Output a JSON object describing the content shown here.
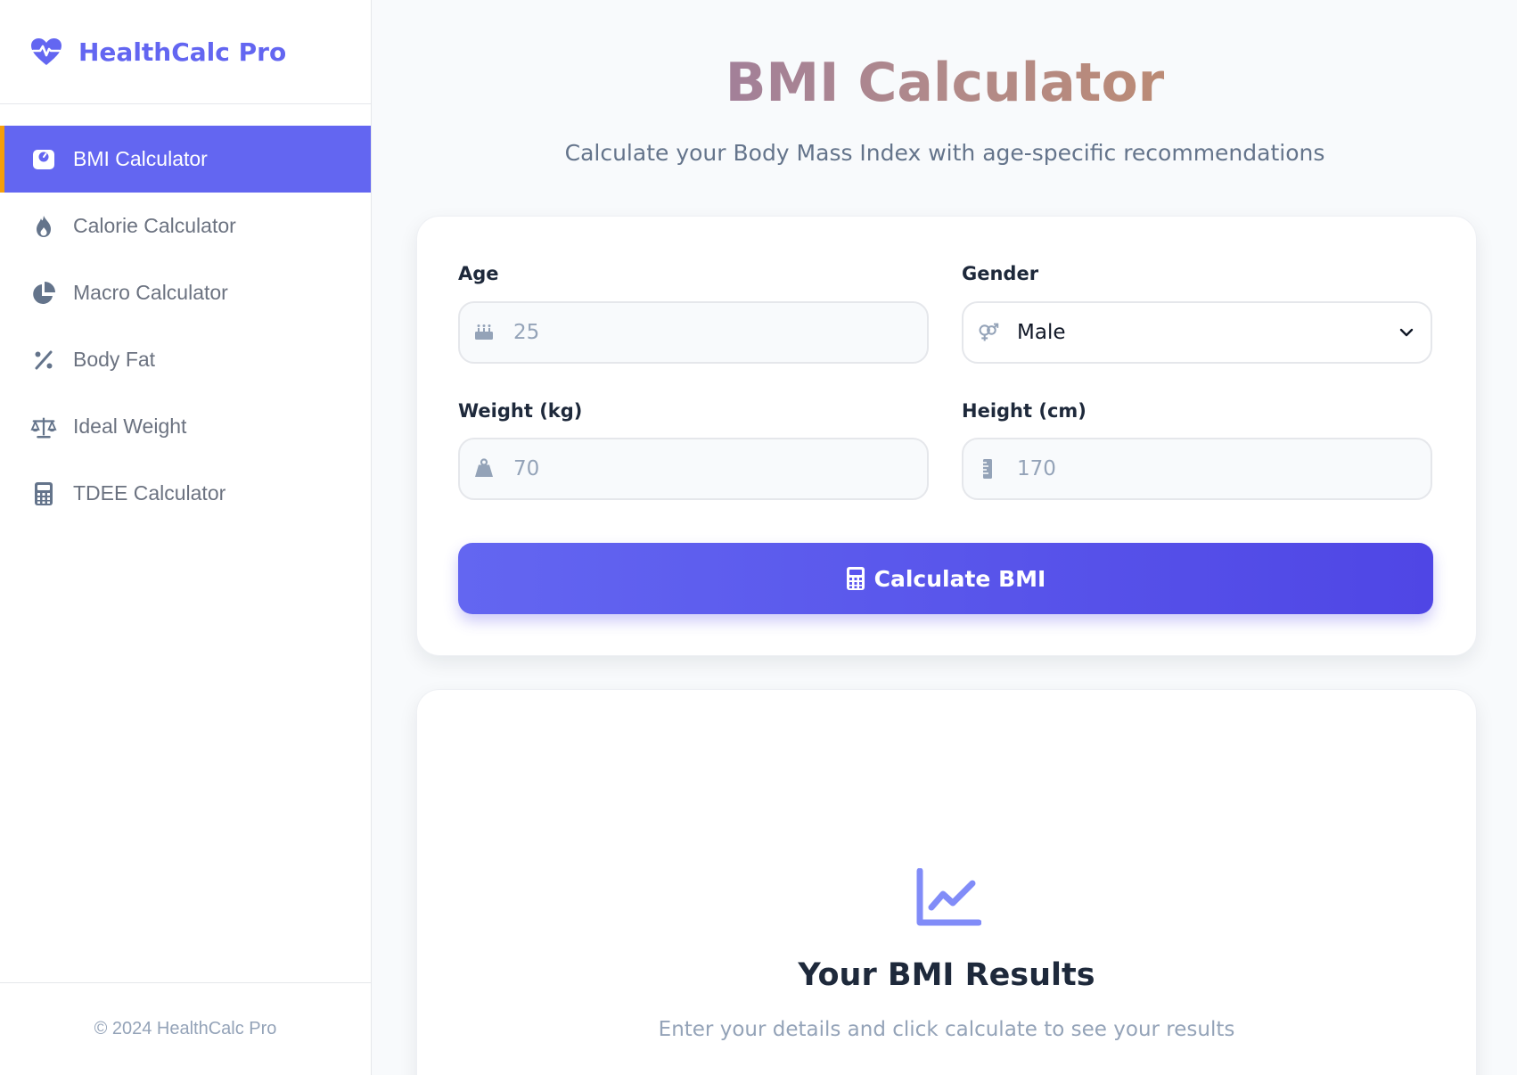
{
  "app": {
    "name": "HealthCalc Pro",
    "logo_icon": "heart-pulse-icon",
    "accent": "#6366f1",
    "active_marker": "#f59e0b"
  },
  "sidebar": {
    "items": [
      {
        "label": "BMI Calculator",
        "icon": "weight-scale-icon",
        "active": true
      },
      {
        "label": "Calorie Calculator",
        "icon": "fire-icon",
        "active": false
      },
      {
        "label": "Macro Calculator",
        "icon": "pie-chart-icon",
        "active": false
      },
      {
        "label": "Body Fat",
        "icon": "percent-icon",
        "active": false
      },
      {
        "label": "Ideal Weight",
        "icon": "balance-scale-icon",
        "active": false
      },
      {
        "label": "TDEE Calculator",
        "icon": "calculator-icon",
        "active": false
      }
    ],
    "footer": "© 2024 HealthCalc Pro"
  },
  "page": {
    "title": "BMI Calculator",
    "subtitle": "Calculate your Body Mass Index with age-specific recommendations"
  },
  "form": {
    "age": {
      "label": "Age",
      "placeholder": "25",
      "icon": "birthday-cake-icon"
    },
    "gender": {
      "label": "Gender",
      "value": "Male",
      "icon": "venus-mars-icon",
      "options": [
        "Male"
      ]
    },
    "weight": {
      "label": "Weight (kg)",
      "placeholder": "70",
      "icon": "weight-hanging-icon"
    },
    "height": {
      "label": "Height (cm)",
      "placeholder": "170",
      "icon": "ruler-icon"
    },
    "submit": {
      "label": "Calculate BMI",
      "icon": "calculator-icon"
    }
  },
  "results": {
    "icon": "line-chart-icon",
    "title": "Your BMI Results",
    "message": "Enter your details and click calculate to see your results"
  }
}
